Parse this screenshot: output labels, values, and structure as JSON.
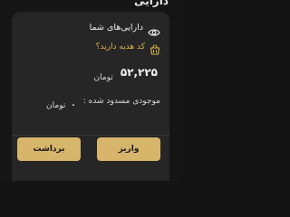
{
  "header": {
    "title": "دارایی"
  },
  "assets": {
    "title": "دارایی‌های شما",
    "eye_icon": "eye-icon"
  },
  "gift": {
    "text": "کد هدیه دارید؟",
    "icon": "gift-basket-icon"
  },
  "balance": {
    "amount": "۵۲,۲۲۵",
    "currency": "تومان"
  },
  "blocked": {
    "label": "موجودی مسدود شده :",
    "amount": "۰",
    "currency": "تومان"
  },
  "actions": {
    "deposit_label": "واریز",
    "withdraw_label": "برداشت"
  },
  "colors": {
    "accent": "#d7b56a",
    "gift_text": "#d9b44a",
    "card_bg": "#262626",
    "page_bg": "#151515"
  }
}
